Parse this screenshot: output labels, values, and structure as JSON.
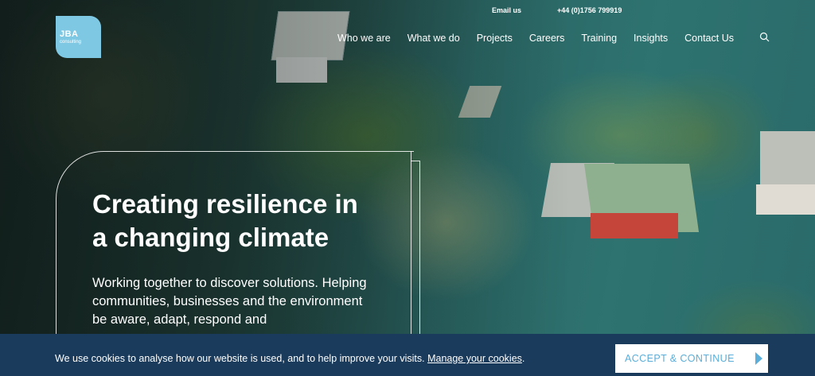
{
  "logo": {
    "name": "JBA",
    "tagline": "consulting"
  },
  "top_links": {
    "email": "Email us",
    "phone": "+44 (0)1756 799919"
  },
  "nav": {
    "items": [
      {
        "label": "Who we are"
      },
      {
        "label": "What we do"
      },
      {
        "label": "Projects"
      },
      {
        "label": "Careers"
      },
      {
        "label": "Training"
      },
      {
        "label": "Insights"
      },
      {
        "label": "Contact Us"
      }
    ],
    "search_icon": "search-icon"
  },
  "hero": {
    "title": "Creating resilience in a changing climate",
    "text": "Working together to discover solutions. Helping communities, businesses and the environment be aware, adapt, respond and"
  },
  "cookie": {
    "text": "We use cookies to analyse how our website is used, and to help improve your visits.",
    "link": "Manage your cookies",
    "period": ".",
    "button": "ACCEPT & CONTINUE"
  },
  "colors": {
    "brand_blue": "#7ec8e3",
    "cookie_bar": "#1a3b5c",
    "button_text": "#5aaed9"
  }
}
